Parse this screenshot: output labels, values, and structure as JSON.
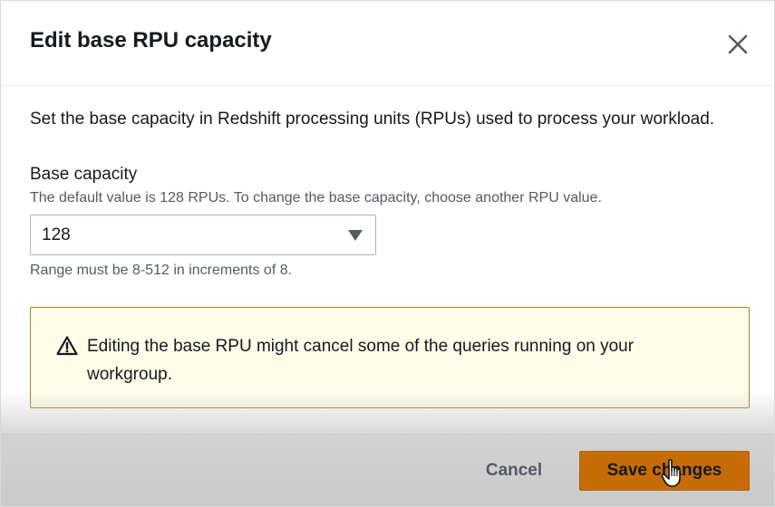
{
  "modal": {
    "title": "Edit base RPU capacity",
    "close_icon": "close-icon",
    "description": "Set the base capacity in Redshift processing units (RPUs) used to process your workload."
  },
  "base_capacity": {
    "label": "Base capacity",
    "description": "The default value is 128 RPUs. To change the base capacity, choose another RPU value.",
    "selected_value": "128",
    "dropdown_icon": "caret-down-icon",
    "constraint": "Range must be 8-512 in increments of 8."
  },
  "alert": {
    "icon": "warning-icon",
    "text": "Editing the base RPU might cancel some of the queries running on your workgroup."
  },
  "footer": {
    "cancel_label": "Cancel",
    "save_label": "Save changes"
  },
  "colors": {
    "primary_button": "#c66c07",
    "alert_background": "#fffce9",
    "alert_border": "#b07d21",
    "text": "#16191f",
    "secondary_text": "#545b64"
  }
}
